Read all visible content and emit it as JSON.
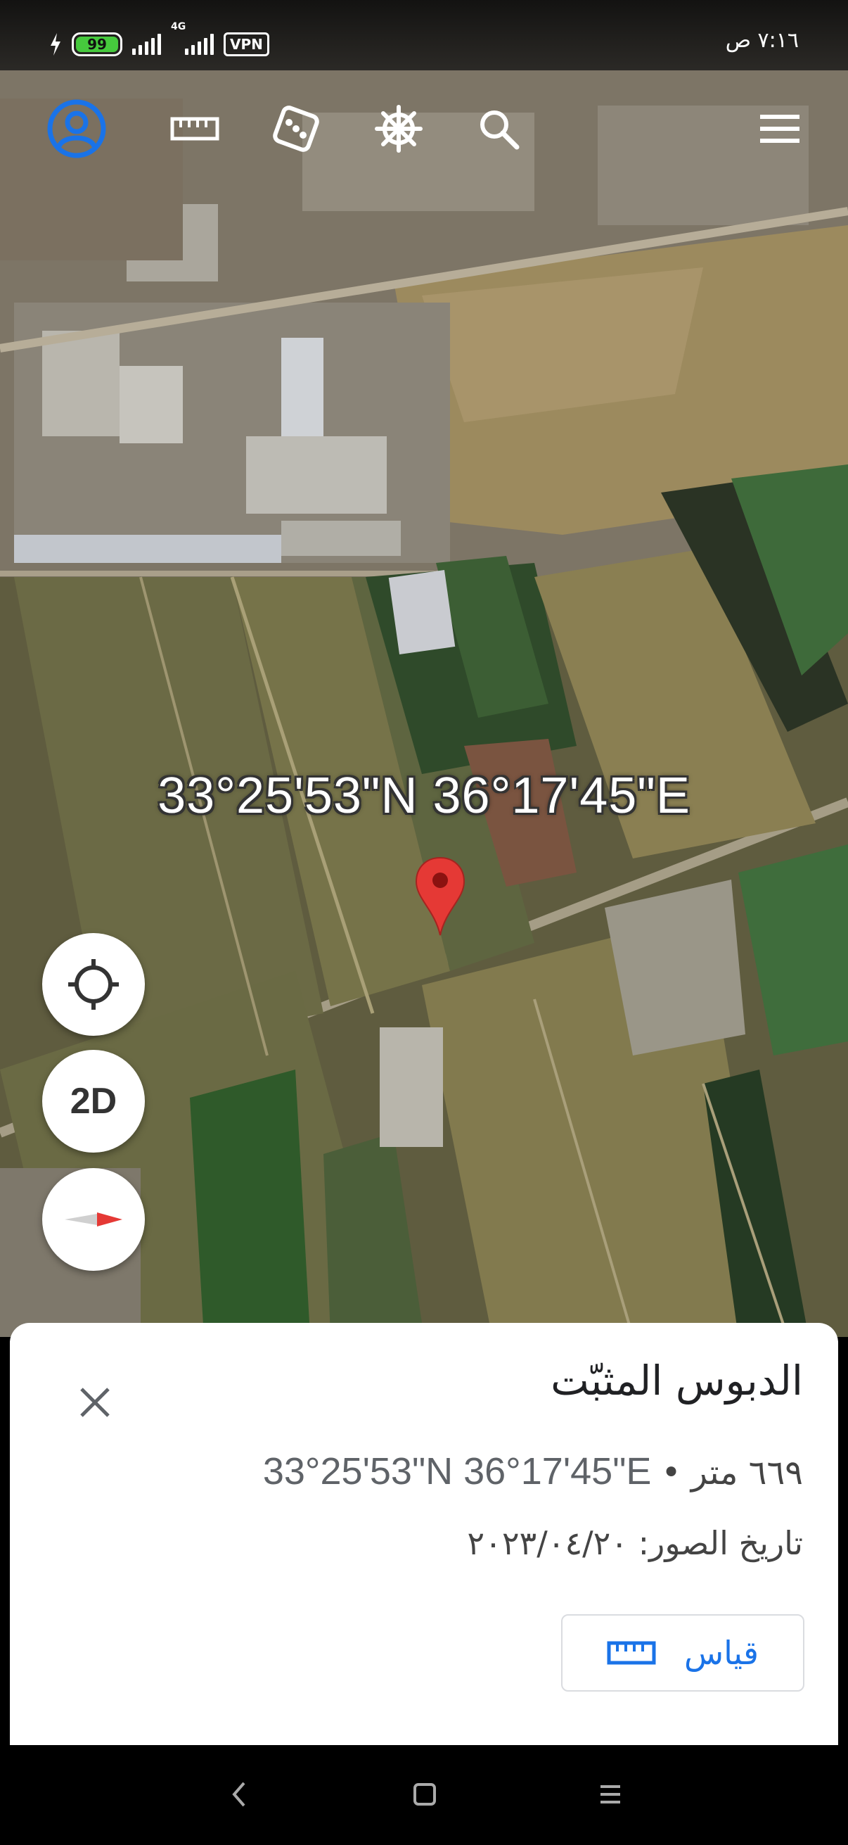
{
  "status_bar": {
    "time": "٧:١٦ ص",
    "battery_level": "99",
    "network_label": "4G",
    "vpn_label": "VPN",
    "icons": [
      "charging-bolt-icon",
      "battery-icon",
      "signal-icon",
      "signal-4g-icon",
      "vpn-icon"
    ]
  },
  "toolbar": {
    "icons": [
      "profile-icon",
      "ruler-icon",
      "dice-icon",
      "ship-wheel-icon",
      "search-icon",
      "menu-icon"
    ],
    "accent_color": "#1a73e8"
  },
  "map": {
    "coordinates_overlay": "33°25'53\"N 36°17'45\"E",
    "pin_icon": "map-pin-icon",
    "pin_color": "#e53935"
  },
  "map_controls": {
    "locate_icon": "crosshair-icon",
    "view_mode_label": "2D",
    "compass_icon": "compass-icon"
  },
  "bottom_sheet": {
    "title": "الدبوس المثبّت",
    "distance": "٦٦٩ متر",
    "separator": "•",
    "coordinates": "33°25'53\"N 36°17'45\"E",
    "imagery_date": "تاريخ الصور: ٢٠٢٣/٠٤/٢٠",
    "measure_label": "قياس",
    "close_icon": "close-icon",
    "measure_icon": "ruler-icon"
  },
  "nav_bar": {
    "icons": [
      "back-icon",
      "home-icon",
      "recents-icon"
    ]
  }
}
